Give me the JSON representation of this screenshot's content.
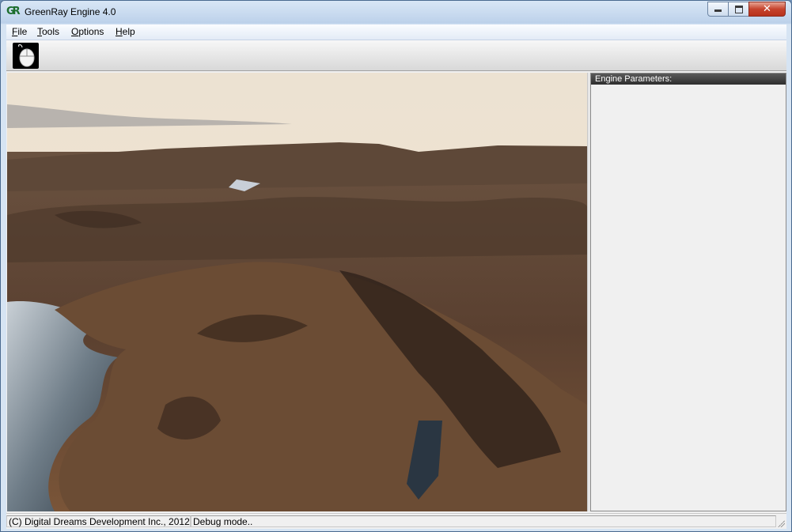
{
  "window": {
    "title": "GreenRay Engine 4.0",
    "icon_text": "GR",
    "controls": [
      "minimize",
      "maximize",
      "close"
    ]
  },
  "menu": {
    "items": [
      {
        "hotkey": "F",
        "rest": "ile"
      },
      {
        "hotkey": "T",
        "rest": "ools"
      },
      {
        "hotkey": "O",
        "rest": "ptions"
      },
      {
        "hotkey": "H",
        "rest": "elp"
      }
    ]
  },
  "toolbar": {
    "buttons": [
      {
        "icon": "mouse-icon"
      }
    ]
  },
  "viewport": {
    "content": "terrain-render"
  },
  "params_panel": {
    "header": "Engine Parameters:"
  },
  "status": {
    "copyright": "(C) Digital Dreams Development Inc., 2012",
    "mode": "Debug mode.."
  },
  "colors": {
    "title_bar": "#bcd1ea",
    "close_button": "#c6432d",
    "panel_header": "#3a3a3a"
  }
}
